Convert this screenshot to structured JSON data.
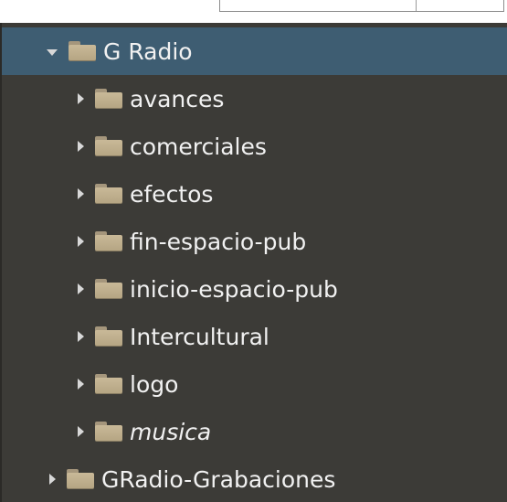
{
  "tree": {
    "root": {
      "label": "G Radio",
      "expanded": true,
      "selected": true,
      "icon": "folder-icon"
    },
    "children": [
      {
        "label": "avances",
        "italic": false
      },
      {
        "label": "comerciales",
        "italic": false
      },
      {
        "label": "efectos",
        "italic": false
      },
      {
        "label": "fin-espacio-pub",
        "italic": false
      },
      {
        "label": "inicio-espacio-pub",
        "italic": false
      },
      {
        "label": "Intercultural",
        "italic": false
      },
      {
        "label": "logo",
        "italic": false
      },
      {
        "label": "musica",
        "italic": true
      }
    ],
    "sibling": {
      "label": "GRadio-Grabaciones",
      "expanded": false
    }
  },
  "colors": {
    "background": "#3c3b37",
    "selection": "#3e5d72",
    "text": "#f1f1f1",
    "folder": "#c9b998"
  }
}
